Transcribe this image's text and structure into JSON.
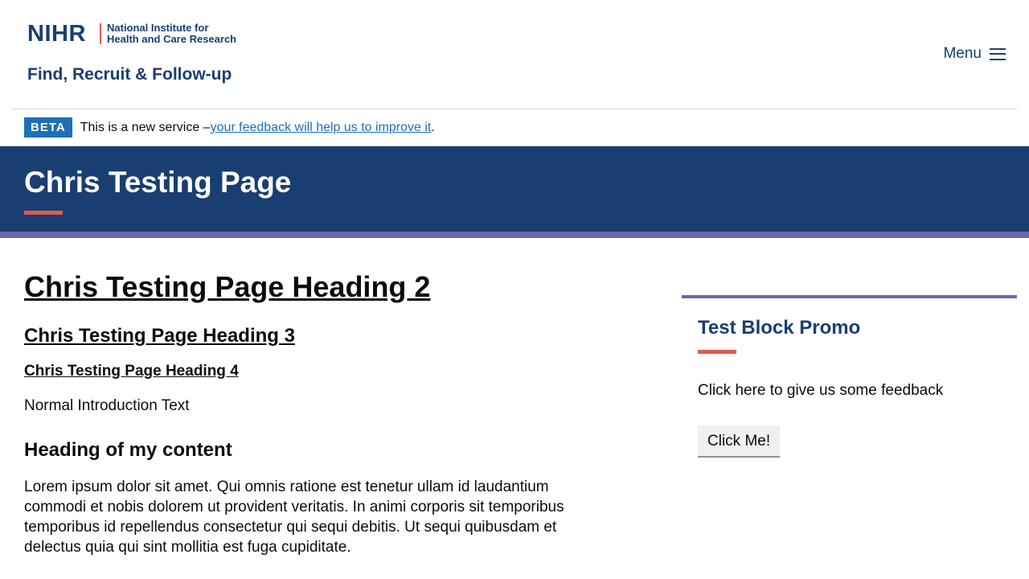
{
  "header": {
    "logo_mark": "NIHR",
    "logo_line1": "National Institute for",
    "logo_line2": "Health and Care Research",
    "service_name": "Find, Recruit & Follow-up",
    "menu_label": "Menu"
  },
  "beta": {
    "tag": "BETA",
    "text": "This is a new service – ",
    "link_text": "your feedback will help us to improve it",
    "suffix": "."
  },
  "hero": {
    "title": "Chris Testing Page"
  },
  "main": {
    "heading2": "Chris Testing Page Heading 2",
    "heading3": "Chris Testing Page Heading 3",
    "heading4": "Chris Testing Page Heading 4",
    "intro": "Normal Introduction Text",
    "content_heading": "Heading of my content",
    "body": "Lorem ipsum dolor sit amet. Qui omnis ratione est tenetur ullam id laudantium commodi et nobis dolorem ut provident veritatis. In animi corporis sit temporibus temporibus id repellendus consectetur qui sequi debitis. Ut sequi quibusdam et delectus quia qui sint mollitia est fuga cupiditate."
  },
  "promo": {
    "title": "Test Block Promo",
    "text": "Click here to give us some feedback",
    "button_label": "Click Me!"
  },
  "colors": {
    "brand_blue": "#193e72",
    "accent_red": "#e05b4c",
    "accent_purple": "#6c66ae",
    "link_blue": "#1d70b8"
  }
}
